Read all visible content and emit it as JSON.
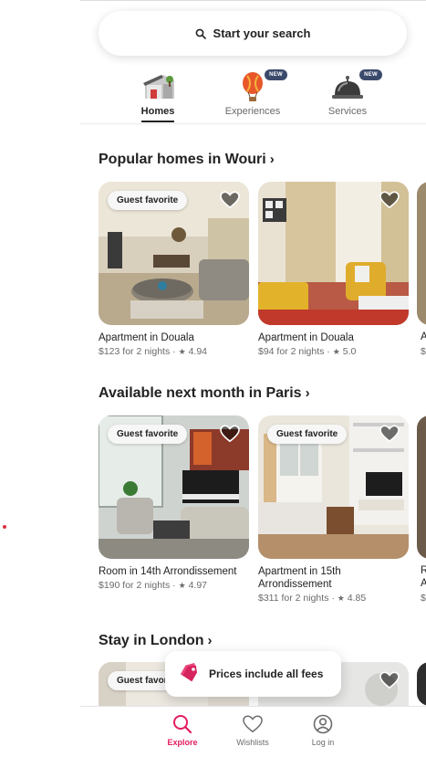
{
  "search": {
    "label": "Start your search",
    "icon": "search-icon"
  },
  "categories": [
    {
      "label": "Homes",
      "icon": "house-icon",
      "active": true,
      "badge": ""
    },
    {
      "label": "Experiences",
      "icon": "hot-air-balloon-icon",
      "active": false,
      "badge": "NEW"
    },
    {
      "label": "Services",
      "icon": "service-bell-icon",
      "active": false,
      "badge": "NEW"
    }
  ],
  "sections": [
    {
      "title": "Popular homes in Wouri",
      "listings": [
        {
          "badge": "Guest favorite",
          "name": "Apartment in Douala",
          "price": "$123 for 2 nights",
          "rating": "4.94"
        },
        {
          "badge": "",
          "name": "Apartment in Douala",
          "price": "$94 for 2 nights",
          "rating": "5.0"
        }
      ],
      "peek": {
        "name": "A",
        "meta": "$"
      }
    },
    {
      "title": "Available next month in Paris",
      "listings": [
        {
          "badge": "Guest favorite",
          "name": "Room in 14th Arrondissement",
          "price": "$190 for 2 nights",
          "rating": "4.97"
        },
        {
          "badge": "Guest favorite",
          "name": "Apartment in 15th Arrondissement",
          "price": "$311 for 2 nights",
          "rating": "4.85"
        }
      ],
      "peek": {
        "name": "R",
        "name2": "A",
        "meta": "$"
      }
    },
    {
      "title": "Stay in London",
      "listings": [
        {
          "badge": "Guest favorite"
        }
      ]
    }
  ],
  "toast": {
    "label": "Prices include all fees",
    "icon": "price-tag-icon"
  },
  "bottom_nav": [
    {
      "label": "Explore",
      "icon": "search-icon",
      "active": true
    },
    {
      "label": "Wishlists",
      "icon": "heart-outline-icon",
      "active": false
    },
    {
      "label": "Log in",
      "icon": "user-circle-icon",
      "active": false
    }
  ],
  "colors": {
    "brand": "#e31c5f",
    "badge_bg": "#3a4a6b",
    "text": "#222222",
    "muted": "#6a6a6a"
  }
}
